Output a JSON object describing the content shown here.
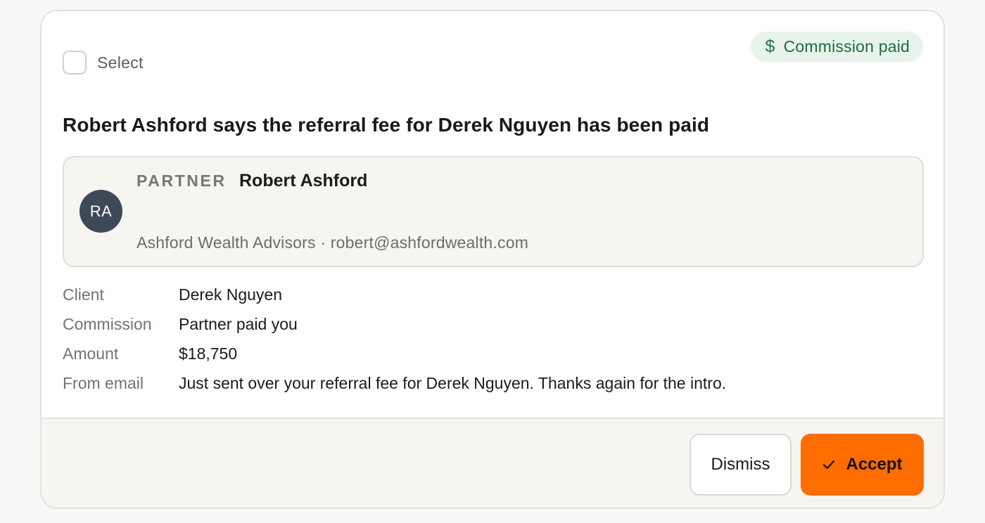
{
  "select": {
    "label": "Select",
    "checked": false
  },
  "status_badge": {
    "icon": "dollar-icon",
    "icon_glyph": "$",
    "label": "Commission paid",
    "color": "#1f6b40"
  },
  "headline": "Robert Ashford says the referral fee for Derek Nguyen has been paid",
  "partner": {
    "initials": "RA",
    "role": "PARTNER",
    "name": "Robert Ashford",
    "meta": "Ashford Wealth Advisors · robert@ashfordwealth.com",
    "avatar_color": "#3d4859"
  },
  "details": [
    {
      "label": "Client",
      "value": "Derek Nguyen"
    },
    {
      "label": "Commission",
      "value": "Partner paid you"
    },
    {
      "label": "Amount",
      "value": "$18,750"
    },
    {
      "label": "From email",
      "value": "Just sent over your referral fee for Derek Nguyen. Thanks again for the intro."
    }
  ],
  "actions": {
    "dismiss_label": "Dismiss",
    "accept_label": "Accept",
    "accept_icon": "check-icon",
    "accent_color": "#ff6d00"
  }
}
